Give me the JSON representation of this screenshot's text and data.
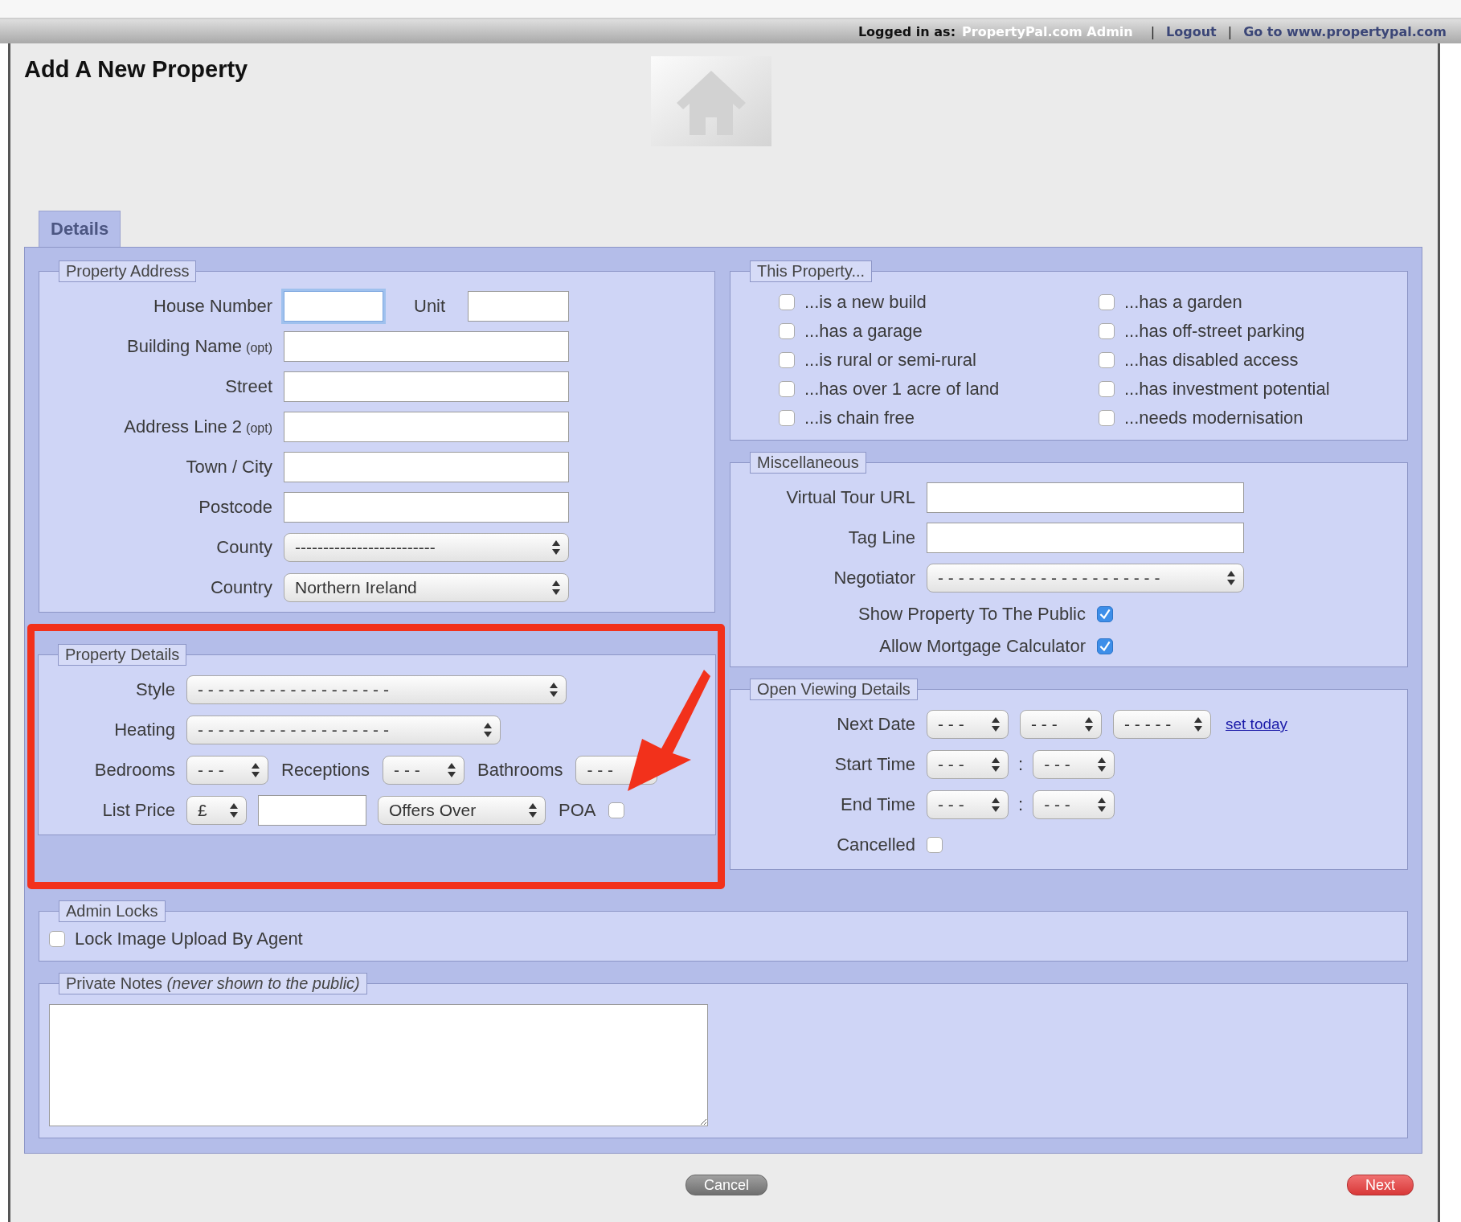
{
  "top_bar": {
    "logged_in_label": "Logged in as:",
    "user": "PropertyPal.com Admin",
    "separator_1": "|",
    "logout": "Logout",
    "separator_2": "|",
    "site_link": "Go to www.propertypal.com"
  },
  "page_title": "Add A New Property",
  "tabs": [
    {
      "label": "Details",
      "selected": true
    }
  ],
  "property_address": {
    "legend": "Property Address",
    "rows": [
      {
        "label": "House Number",
        "controls": [
          {
            "kind": "text",
            "focused": true
          },
          {
            "kind": "label",
            "text": "Unit"
          },
          {
            "kind": "text",
            "focused": false
          }
        ]
      },
      {
        "label": "Building Name",
        "note": "(opt)",
        "controls": [
          {
            "kind": "text",
            "focused": false
          }
        ]
      },
      {
        "label": "Street",
        "controls": [
          {
            "kind": "text",
            "focused": false
          }
        ]
      },
      {
        "label": "Address Line 2",
        "note": "(opt)",
        "controls": [
          {
            "kind": "text",
            "focused": false
          }
        ]
      },
      {
        "label": "Town / City",
        "controls": [
          {
            "kind": "text",
            "focused": false
          }
        ]
      },
      {
        "label": "Postcode",
        "controls": [
          {
            "kind": "text",
            "focused": false
          }
        ]
      },
      {
        "label": "County",
        "controls": [
          {
            "kind": "select",
            "value": "-------------------------"
          }
        ]
      },
      {
        "label": "Country",
        "controls": [
          {
            "kind": "select",
            "value": "Northern Ireland"
          }
        ]
      }
    ]
  },
  "property_details": {
    "legend": "Property Details",
    "rows": [
      {
        "label": "Style",
        "controls": [
          {
            "kind": "select",
            "value": "- - - - - - - - - - - - - - - - - - -"
          }
        ]
      },
      {
        "label": "Heating",
        "controls": [
          {
            "kind": "select",
            "value": "- - - - - - - - - - - - - - - - - - -"
          }
        ]
      },
      {
        "label": "Bedrooms",
        "controls": [
          {
            "kind": "select",
            "value": "- - -"
          },
          {
            "kind": "label",
            "text": "Receptions"
          },
          {
            "kind": "select",
            "value": "- - -"
          },
          {
            "kind": "label",
            "text": "Bathrooms"
          },
          {
            "kind": "select",
            "value": "- - -"
          }
        ]
      },
      {
        "label": "List Price",
        "controls": [
          {
            "kind": "select",
            "value": "£"
          },
          {
            "kind": "text",
            "focused": false
          },
          {
            "kind": "select",
            "value": "Offers Over"
          },
          {
            "kind": "label",
            "text": "POA"
          },
          {
            "kind": "checkbox",
            "checked": false
          }
        ]
      }
    ]
  },
  "this_property": {
    "legend": "This Property...",
    "items": [
      {
        "label": "...is a new build",
        "checked": false
      },
      {
        "label": "...has a garden",
        "checked": false
      },
      {
        "label": "...has a garage",
        "checked": false
      },
      {
        "label": "...has off-street parking",
        "checked": false
      },
      {
        "label": "...is rural or semi-rural",
        "checked": false
      },
      {
        "label": "...has disabled access",
        "checked": false
      },
      {
        "label": "...has over 1 acre of land",
        "checked": false
      },
      {
        "label": "...has investment potential",
        "checked": false
      },
      {
        "label": "...is chain free",
        "checked": false
      },
      {
        "label": "...needs modernisation",
        "checked": false
      }
    ]
  },
  "miscellaneous": {
    "legend": "Miscellaneous",
    "rows": [
      {
        "label": "Virtual Tour URL",
        "controls": [
          {
            "kind": "text",
            "focused": false
          }
        ]
      },
      {
        "label": "Tag Line",
        "controls": [
          {
            "kind": "text",
            "focused": false
          }
        ]
      },
      {
        "label": "Negotiator",
        "controls": [
          {
            "kind": "select",
            "value": "- - - - - - - - - - - - - - - - - - - - - -"
          }
        ]
      },
      {
        "label": "Show Property To The Public",
        "controls": [
          {
            "kind": "checkbox",
            "checked": true
          }
        ]
      },
      {
        "label": "Allow Mortgage Calculator",
        "controls": [
          {
            "kind": "checkbox",
            "checked": true
          }
        ]
      }
    ]
  },
  "open_viewing": {
    "legend": "Open Viewing Details",
    "rows": [
      {
        "label": "Next Date",
        "controls": [
          {
            "kind": "select",
            "value": "- - -"
          },
          {
            "kind": "select",
            "value": "- - -"
          },
          {
            "kind": "select",
            "value": "- - - - -"
          },
          {
            "kind": "link",
            "text": "set today"
          }
        ]
      },
      {
        "label": "Start Time",
        "controls": [
          {
            "kind": "select",
            "value": "- - -"
          },
          {
            "kind": "separator",
            "text": ":"
          },
          {
            "kind": "select",
            "value": "- - -"
          }
        ]
      },
      {
        "label": "End Time",
        "controls": [
          {
            "kind": "select",
            "value": "- - -"
          },
          {
            "kind": "separator",
            "text": ":"
          },
          {
            "kind": "select",
            "value": "- - -"
          }
        ]
      },
      {
        "label": "Cancelled",
        "controls": [
          {
            "kind": "checkbox",
            "checked": false
          }
        ]
      }
    ]
  },
  "admin_locks": {
    "legend": "Admin Locks",
    "items": [
      {
        "label": "Lock Image Upload By Agent",
        "checked": false
      }
    ]
  },
  "private_notes": {
    "legend": "Private Notes *(never shown to the public)*"
  },
  "buttons": [
    {
      "label": "Cancel",
      "kind": "cancel"
    },
    {
      "label": "Next",
      "kind": "next"
    }
  ]
}
